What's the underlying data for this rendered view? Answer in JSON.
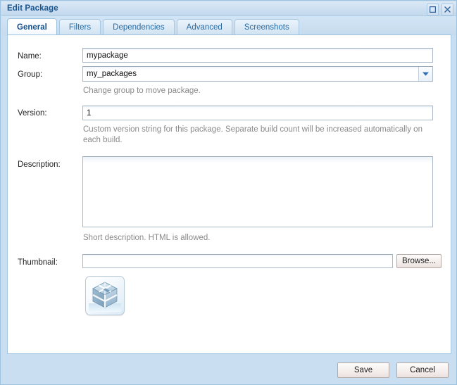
{
  "window": {
    "title": "Edit Package",
    "controls": [
      {
        "name": "maximize-button",
        "icon": "maximize-icon"
      },
      {
        "name": "close-button",
        "icon": "close-icon"
      }
    ]
  },
  "tabs": [
    {
      "label": "General",
      "active": true
    },
    {
      "label": "Filters",
      "active": false
    },
    {
      "label": "Dependencies",
      "active": false
    },
    {
      "label": "Advanced",
      "active": false
    },
    {
      "label": "Screenshots",
      "active": false
    }
  ],
  "form": {
    "name": {
      "label": "Name:",
      "value": "mypackage",
      "placeholder": ""
    },
    "group": {
      "label": "Group:",
      "value": "my_packages",
      "options": [
        "my_packages"
      ],
      "help": "Change group to move package.",
      "arrow_icon": "chevron-down-icon"
    },
    "version": {
      "label": "Version:",
      "value": "1",
      "placeholder": "",
      "help": "Custom version string for this package. Separate build count will be increased automatically on each build."
    },
    "description": {
      "label": "Description:",
      "value": "",
      "placeholder": "",
      "help": "Short description. HTML is allowed."
    },
    "thumbnail": {
      "label": "Thumbnail:",
      "value": "",
      "placeholder": "",
      "browse_label": "Browse...",
      "preview_icon": "package-cube-icon"
    }
  },
  "footer": {
    "save_label": "Save",
    "cancel_label": "Cancel"
  },
  "colors": {
    "window_chrome": "#c9def0",
    "title_text": "#18548f",
    "tab_text": "#2b6ca3",
    "active_tab_text": "#14508c",
    "help_text": "#8a8a8a",
    "field_border": "#a9b9c9",
    "panel_border": "#a6c7e1"
  }
}
